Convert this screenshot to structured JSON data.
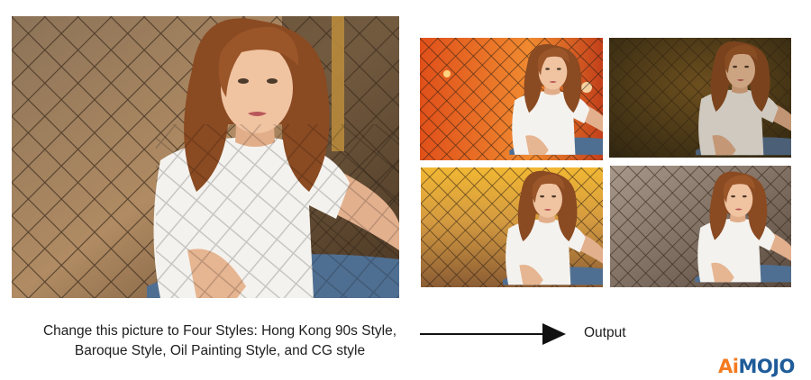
{
  "images": {
    "original": {
      "subject": "woman-white-tshirt-chainlink-fence"
    },
    "outputs": [
      {
        "style": "Hong Kong 90s Style"
      },
      {
        "style": "Baroque Style"
      },
      {
        "style": "Oil Painting Style"
      },
      {
        "style": "CG style"
      }
    ]
  },
  "prompt": {
    "line1": "Change this picture to Four Styles: Hong Kong 90s Style,",
    "line2": "Baroque Style, Oil Painting Style, and CG style"
  },
  "output_label": "Output",
  "logo": {
    "part1": "Ai",
    "part2": "MOJO"
  },
  "colors": {
    "text": "#1d1d1d",
    "arrow": "#111111",
    "logo_accent": "#f47b20",
    "logo_main": "#1f5c99"
  }
}
